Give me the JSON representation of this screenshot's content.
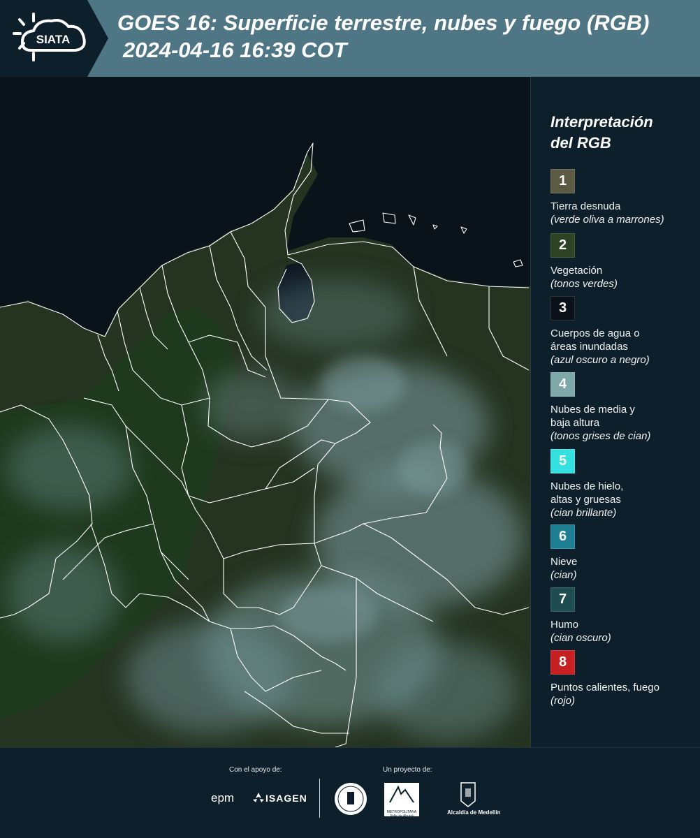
{
  "header": {
    "logo_text": "SIATA",
    "title": "GOES 16: Superficie terrestre, nubes y fuego (RGB)",
    "timestamp": "2024-04-16 16:39 COT"
  },
  "legend": {
    "title_line1": "Interpretación",
    "title_line2": "del RGB",
    "items": [
      {
        "num": "1",
        "color": "#5b5a42",
        "label_lines": [
          "Tierra desnuda"
        ],
        "desc": "(verde oliva a marrones)"
      },
      {
        "num": "2",
        "color": "#2d4222",
        "label_lines": [
          "Vegetación"
        ],
        "desc": "(tonos verdes)"
      },
      {
        "num": "3",
        "color": "#0b1119",
        "label_lines": [
          "Cuerpos de agua o",
          "áreas inundadas"
        ],
        "desc": "(azul oscuro a negro)"
      },
      {
        "num": "4",
        "color": "#7fa8a9",
        "label_lines": [
          "Nubes de media y",
          "baja altura"
        ],
        "desc": "(tonos grises de cian)"
      },
      {
        "num": "5",
        "color": "#35e0e0",
        "label_lines": [
          "Nubes de hielo,",
          "altas y gruesas"
        ],
        "desc": "(cian brillante)"
      },
      {
        "num": "6",
        "color": "#1c7f94",
        "label_lines": [
          "Nieve"
        ],
        "desc": "(cian)"
      },
      {
        "num": "7",
        "color": "#1d4d50",
        "label_lines": [
          "Humo"
        ],
        "desc": "(cian oscuro)"
      },
      {
        "num": "8",
        "color": "#c62022",
        "label_lines": [
          "Puntos calientes, fuego"
        ],
        "desc": "(rojo)"
      }
    ]
  },
  "footer": {
    "support_label": "Con el apoyo de:",
    "project_label": "Un proyecto de:",
    "sponsors": [
      "epm",
      "ISAGEN"
    ],
    "partners": [
      "METROPOLITANA Valle de Aburrá",
      "Alcaldía de Medellín"
    ]
  },
  "colors": {
    "background": "#0d1f2a",
    "header_band": "#4f7685",
    "map_ocean": "#0a1219",
    "vegetation": "#2d4222",
    "cloud": "#7fa8a9",
    "border_line": "#ffffff"
  }
}
